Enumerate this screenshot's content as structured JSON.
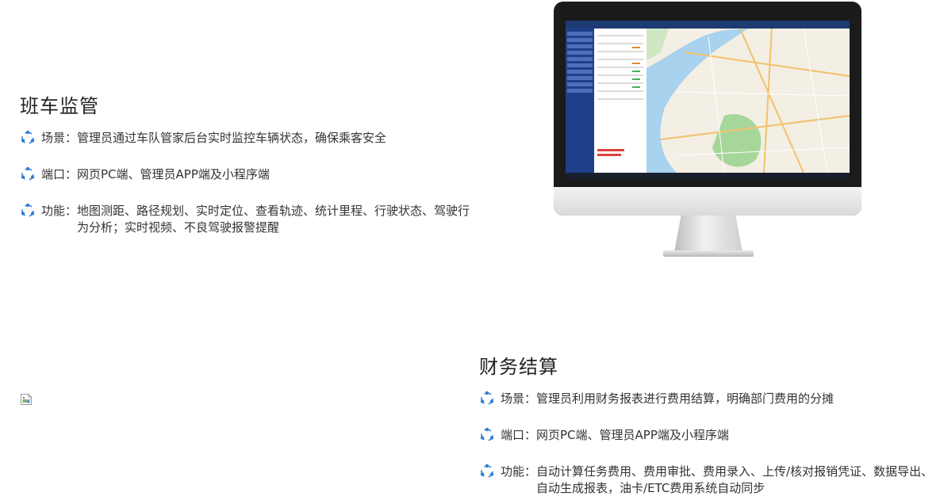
{
  "section1": {
    "title": "班车监管",
    "items": [
      {
        "label": "场景：",
        "text": "管理员通过车队管家后台实时监控车辆状态，确保乘客安全"
      },
      {
        "label": "端口：",
        "text": "网页PC端、管理员APP端及小程序端"
      },
      {
        "label": "功能：",
        "text": "地图测距、路径规划、实时定位、查看轨迹、统计里程、行驶状态、驾驶行为分析；实时视频、不良驾驶报警提醒"
      }
    ]
  },
  "section2": {
    "title": "财务结算",
    "items": [
      {
        "label": "场景：",
        "text": "管理员利用财务报表进行费用结算，明确部门费用的分摊"
      },
      {
        "label": "端口：",
        "text": "网页PC端、管理员APP端及小程序端"
      },
      {
        "label": "功能：",
        "text": "自动计算任务费用、费用审批、费用录入、上传/核对报销凭证、数据导出、自动生成报表，油卡/ETC费用系统自动同步"
      }
    ]
  },
  "colors": {
    "icon_accent": "#2f7fd6",
    "title": "#222222",
    "body_text": "#333333"
  }
}
